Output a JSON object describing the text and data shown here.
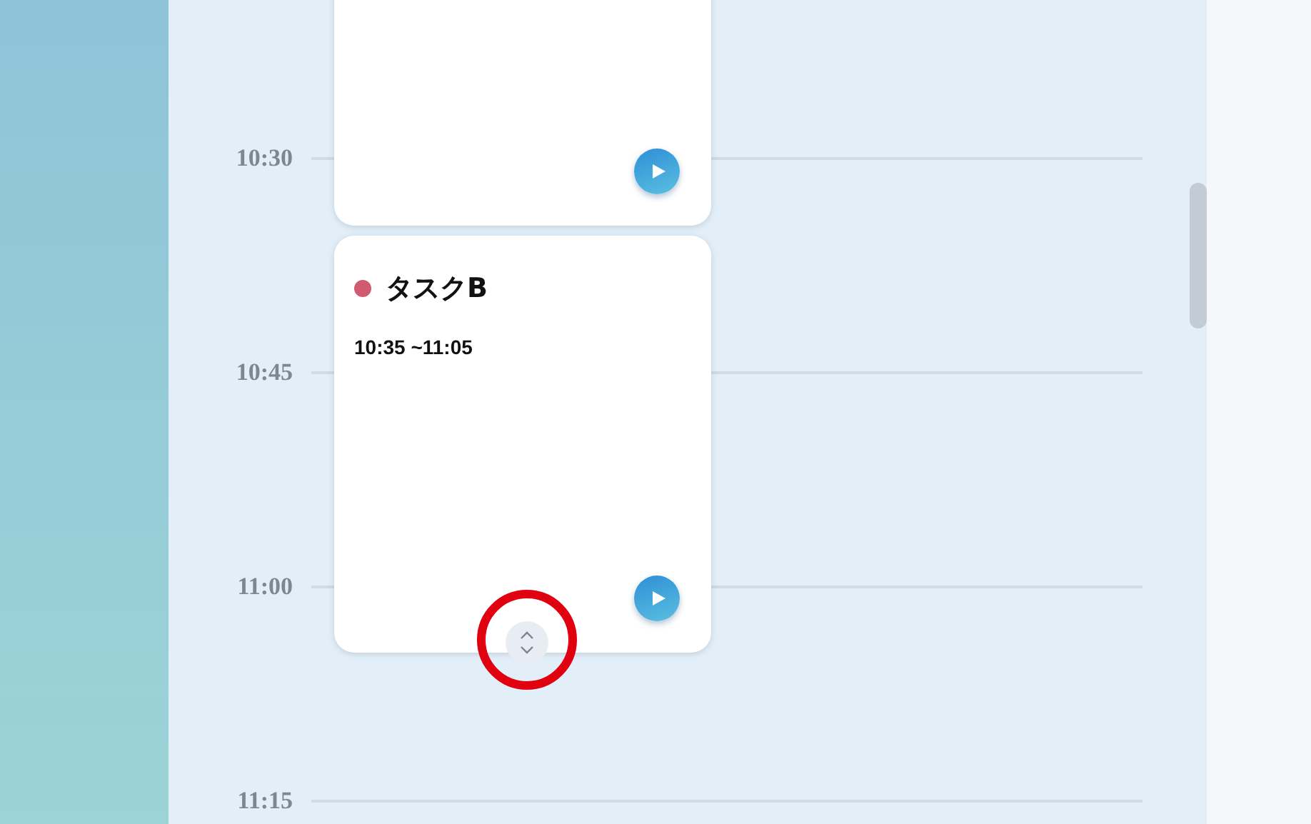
{
  "times": [
    "10:30",
    "10:45",
    "11:00",
    "11:15"
  ],
  "tasks": [
    {
      "kind": "partial"
    },
    {
      "kind": "full",
      "title": "タスクB",
      "time": "10:35 ~11:05",
      "color": "#d05a6e",
      "resize_handle": true
    }
  ],
  "annotation": {
    "kind": "circle"
  }
}
